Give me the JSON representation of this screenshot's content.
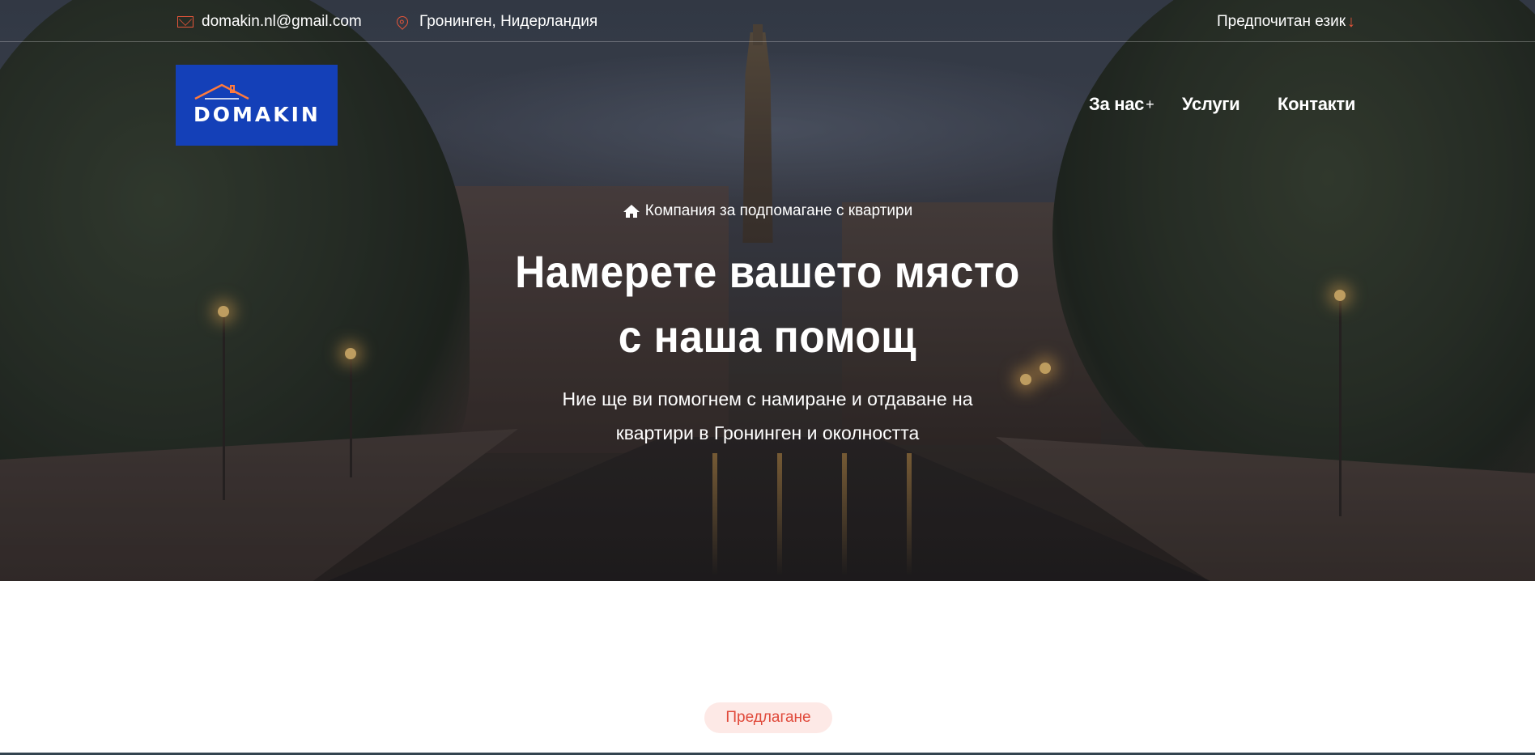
{
  "topbar": {
    "email": "domakin.nl@gmail.com",
    "location": "Гронинген, Нидерландия",
    "language_label": "Предпочитан език",
    "language_arrow": "↓"
  },
  "logo": {
    "text": "DOMAKIN"
  },
  "nav": {
    "items": [
      {
        "label": "За нас",
        "suffix": "+"
      },
      {
        "label": "Услуги"
      },
      {
        "label": "Контакти"
      }
    ]
  },
  "hero": {
    "eyebrow": "Компания за подпомагане с квартири",
    "headline_line1": "Намерете вашето място",
    "headline_line2": "с наша помощ",
    "subtitle_line1": "Ние ще ви помогнем с намиране и отдаване на",
    "subtitle_line2": "квартири в Гронинген и околността"
  },
  "section": {
    "badge": "Предлагане"
  },
  "colors": {
    "accent": "#e6553a",
    "logo_bg": "#1440b8",
    "badge_bg": "#fde9e6",
    "badge_text": "#e0493a"
  },
  "icons": {
    "email": "mail-icon",
    "location": "map-pin-icon",
    "home": "home-icon",
    "language": "arrow-down-icon"
  }
}
